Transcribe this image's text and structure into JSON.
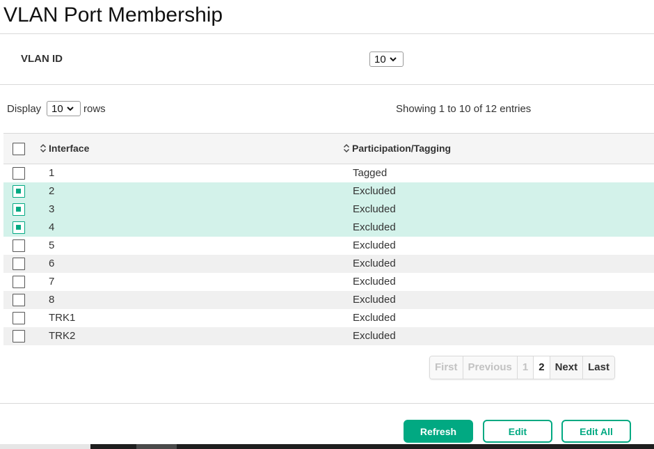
{
  "page": {
    "title": "VLAN Port Membership"
  },
  "vlan": {
    "label": "VLAN ID",
    "selected": "10"
  },
  "display": {
    "label_before": "Display",
    "selected": "10",
    "label_after": "rows"
  },
  "entries_info": "Showing 1 to 10 of 12 entries",
  "table": {
    "headers": {
      "interface": "Interface",
      "participation": "Participation/Tagging"
    },
    "rows": [
      {
        "interface": "1",
        "participation": "Tagged",
        "selected": false
      },
      {
        "interface": "2",
        "participation": "Excluded",
        "selected": true
      },
      {
        "interface": "3",
        "participation": "Excluded",
        "selected": true
      },
      {
        "interface": "4",
        "participation": "Excluded",
        "selected": true
      },
      {
        "interface": "5",
        "participation": "Excluded",
        "selected": false
      },
      {
        "interface": "6",
        "participation": "Excluded",
        "selected": false
      },
      {
        "interface": "7",
        "participation": "Excluded",
        "selected": false
      },
      {
        "interface": "8",
        "participation": "Excluded",
        "selected": false
      },
      {
        "interface": "TRK1",
        "participation": "Excluded",
        "selected": false
      },
      {
        "interface": "TRK2",
        "participation": "Excluded",
        "selected": false
      }
    ]
  },
  "pagination": {
    "first": "First",
    "previous": "Previous",
    "page1": "1",
    "page2": "2",
    "next": "Next",
    "last": "Last",
    "current_page": "2"
  },
  "buttons": {
    "refresh": "Refresh",
    "edit": "Edit",
    "edit_all": "Edit All"
  },
  "colors": {
    "accent": "#01a982",
    "selected_row": "#d3f2ea"
  },
  "icons": {
    "dropdown": "chevron-down-icon",
    "sort": "sort-icon"
  }
}
